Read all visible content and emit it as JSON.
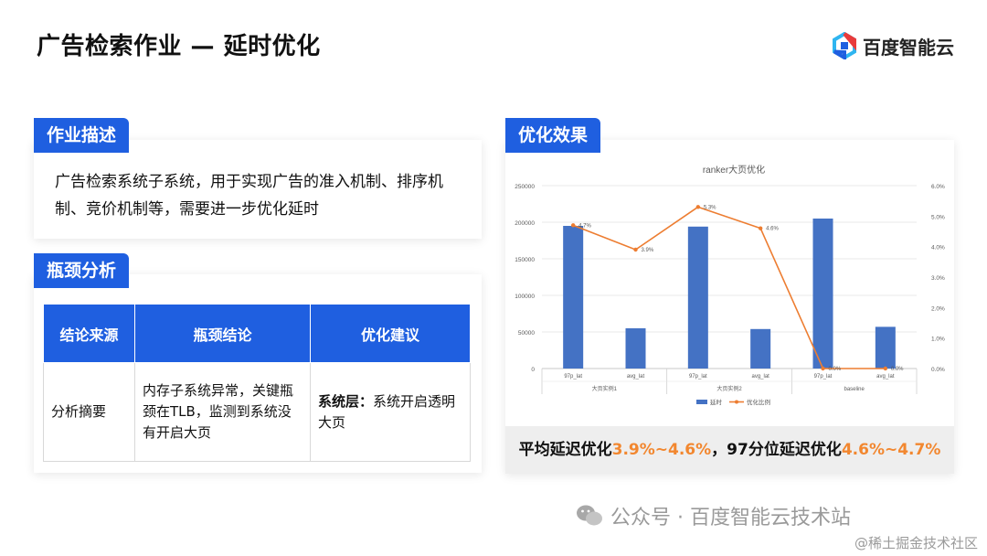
{
  "page": {
    "title": "广告检索作业 — 延时优化"
  },
  "brand": {
    "logo_text": "百度智能云",
    "accent": "#1f5fe0",
    "highlight": "#f2872f"
  },
  "work_desc": {
    "tag": "作业描述",
    "text": "广告检索系统子系统，用于实现广告的准入机制、排序机制、竞价机制等，需要进一步优化延时"
  },
  "bottleneck": {
    "tag": "瓶颈分析",
    "headers": [
      "结论来源",
      "瓶颈结论",
      "优化建议"
    ],
    "row": {
      "source": "分析摘要",
      "conclusion": "内存子系统异常，关键瓶颈在TLB，监测到系统没有开启大页",
      "suggestion_prefix": "系统层：",
      "suggestion_text": "系统开启透明大页"
    }
  },
  "effect": {
    "tag": "优化效果",
    "summary_a": "平均延迟优化",
    "summary_b": "3.9%~4.6%",
    "summary_c": "，97分位延迟优化",
    "summary_d": "4.6%~4.7%"
  },
  "chart_data": {
    "type": "bar",
    "title": "ranker大页优化",
    "categories": [
      "97p_lat",
      "avg_lat",
      "97p_lat",
      "avg_lat",
      "97p_lat",
      "avg_lat"
    ],
    "groups": [
      "大页实例1",
      "大页实例2",
      "baseline"
    ],
    "series": [
      {
        "name": "延时",
        "type": "bar",
        "axis": "left",
        "color": "#4472c4",
        "values": [
          195000,
          55000,
          194000,
          54000,
          205000,
          57000
        ]
      },
      {
        "name": "优化比例",
        "type": "line",
        "axis": "right",
        "color": "#ed7d31",
        "values": [
          0.047,
          0.039,
          0.053,
          0.046,
          0.0,
          0.0
        ],
        "labels": [
          "4.7%",
          "3.9%",
          "5.3%",
          "4.6%",
          "0.0%",
          "0.0%"
        ]
      }
    ],
    "left_axis": {
      "ylim": [
        0,
        250000
      ],
      "ticks": [
        "0",
        "50000",
        "100000",
        "150000",
        "200000",
        "250000"
      ]
    },
    "right_axis": {
      "ylim": [
        0,
        0.06
      ],
      "ticks": [
        "0.0%",
        "1.0%",
        "2.0%",
        "3.0%",
        "4.0%",
        "5.0%",
        "6.0%"
      ]
    },
    "legend": "bottom",
    "grid": true
  },
  "watermark": {
    "text": "公众号 · 百度智能云技术站",
    "site": "@稀土掘金技术社区"
  }
}
